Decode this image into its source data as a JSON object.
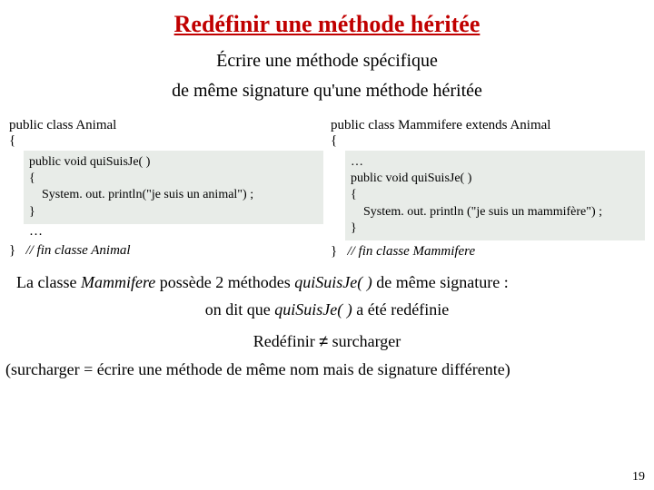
{
  "title": "Redéfinir une méthode héritée",
  "subtitle1": "Écrire une méthode spécifique",
  "subtitle2": "de même signature qu'une méthode héritée",
  "left": {
    "decl": "public class Animal",
    "openBrace": "{",
    "code": "public void quiSuisJe( )\n{\n    System. out. println(\"je suis un animal\") ;\n}",
    "dots": "…",
    "closeBrace": "}",
    "close": "// fin classe Animal"
  },
  "right": {
    "decl": "public class Mammifere extends Animal",
    "openBrace": "{",
    "code": "…\npublic void quiSuisJe( )\n{\n    System. out. println (\"je suis un mammifère\") ;\n}",
    "closeBrace": "}",
    "close": "// fin classe Mammifere"
  },
  "para1_a": "La classe ",
  "para1_b": "Mammifere",
  "para1_c": " possède 2 méthodes ",
  "para1_d": "quiSuisJe( )",
  "para1_e": " de même signature :",
  "para2_a": "on dit que ",
  "para2_b": "quiSuisJe( )",
  "para2_c": " a été redéfinie",
  "para3_a": "Redéfinir ",
  "para3_neq": "≠",
  "para3_b": " surcharger",
  "para4": "(surcharger = écrire une méthode de même nom mais de signature différente)",
  "pagenum": "19"
}
